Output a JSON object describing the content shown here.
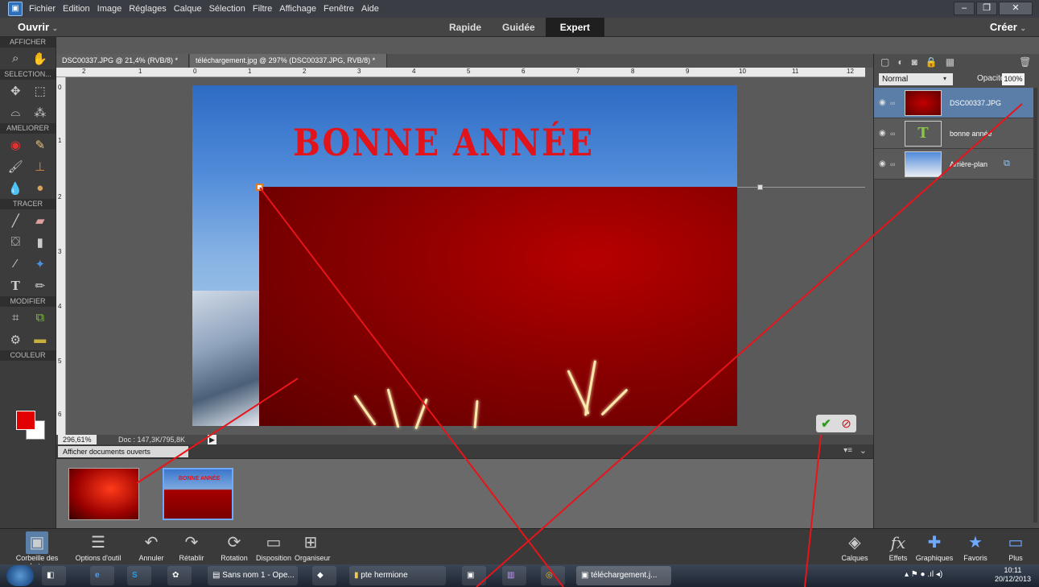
{
  "menubar": {
    "items": [
      "Fichier",
      "Edition",
      "Image",
      "Réglages",
      "Calque",
      "Sélection",
      "Filtre",
      "Affichage",
      "Fenêtre",
      "Aide"
    ]
  },
  "modebar": {
    "open": "Ouvrir",
    "modes": [
      "Rapide",
      "Guidée",
      "Expert"
    ],
    "active_mode": "Expert",
    "create": "Créer"
  },
  "toolbox": {
    "sections": [
      "AFFICHER",
      "SELECTION...",
      "AMELIORER",
      "TRACER",
      "MODIFIER",
      "COULEUR"
    ]
  },
  "tabs": [
    {
      "label": "DSC00337.JPG @ 21,4% (RVB/8) *"
    },
    {
      "label": "téléchargement.jpg @ 297% (DSC00337.JPG, RVB/8) *"
    }
  ],
  "ruler": {
    "top": [
      "2",
      "1",
      "0",
      "1",
      "2",
      "3",
      "4",
      "5",
      "6",
      "7",
      "8",
      "9",
      "10",
      "11",
      "12"
    ],
    "left": [
      "0",
      "1",
      "2",
      "3",
      "4",
      "5",
      "6"
    ]
  },
  "canvas": {
    "text": "BONNE ANNÉE"
  },
  "status": {
    "zoom": "296,61%",
    "doc": "Doc : 147,3K/795,8K"
  },
  "bin": {
    "show_open": "Afficher documents ouverts",
    "thumb2_text": "BONNE ANNÉE"
  },
  "layers_panel": {
    "blend_mode": "Normal",
    "opacity_label": "Opacité :",
    "opacity_value": "100%",
    "layers": [
      {
        "name": "DSC00337.JPG",
        "selected": true
      },
      {
        "name": "bonne année",
        "selected": false
      },
      {
        "name": "Arrière-plan",
        "selected": false
      }
    ]
  },
  "bottom_panel": {
    "left_buttons": [
      "Corbeille des photos",
      "Options d'outil",
      "Annuler",
      "Rétablir",
      "Rotation",
      "Disposition",
      "Organiseur"
    ],
    "right_buttons": [
      "Calques",
      "Effets",
      "Graphiques",
      "Favoris",
      "Plus"
    ]
  },
  "taskbar": {
    "items": [
      "Sans nom 1 - Ope...",
      "pte hermione",
      "téléchargement.j..."
    ],
    "time": "10:11",
    "date": "20/12/2013"
  },
  "colors": {
    "fg": "#e20000",
    "bg": "#ffffff",
    "accent": "#5b7ea8",
    "annotation": "#e8141a"
  }
}
